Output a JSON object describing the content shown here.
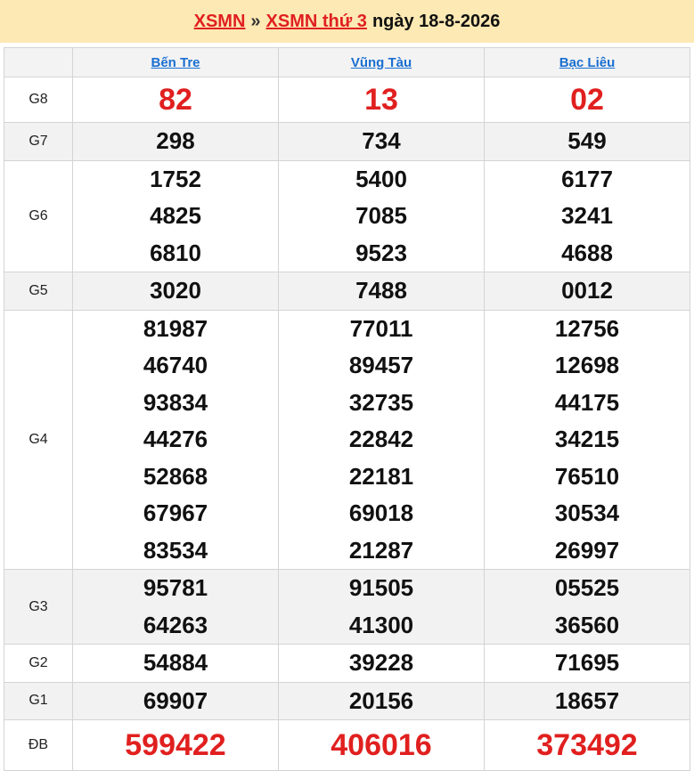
{
  "header": {
    "link1": "XSMN",
    "separator": "»",
    "link2": "XSMN thứ 3",
    "date_text": "ngày 18-8-2026"
  },
  "provinces": [
    "Bến Tre",
    "Vũng Tàu",
    "Bạc Liêu"
  ],
  "prizes": [
    {
      "label": "G8",
      "style": "g8",
      "shade": false,
      "values": [
        [
          "82"
        ],
        [
          "13"
        ],
        [
          "02"
        ]
      ]
    },
    {
      "label": "G7",
      "style": "",
      "shade": true,
      "values": [
        [
          "298"
        ],
        [
          "734"
        ],
        [
          "549"
        ]
      ]
    },
    {
      "label": "G6",
      "style": "",
      "shade": false,
      "values": [
        [
          "1752",
          "4825",
          "6810"
        ],
        [
          "5400",
          "7085",
          "9523"
        ],
        [
          "6177",
          "3241",
          "4688"
        ]
      ]
    },
    {
      "label": "G5",
      "style": "",
      "shade": true,
      "values": [
        [
          "3020"
        ],
        [
          "7488"
        ],
        [
          "0012"
        ]
      ]
    },
    {
      "label": "G4",
      "style": "",
      "shade": false,
      "values": [
        [
          "81987",
          "46740",
          "93834",
          "44276",
          "52868",
          "67967",
          "83534"
        ],
        [
          "77011",
          "89457",
          "32735",
          "22842",
          "22181",
          "69018",
          "21287"
        ],
        [
          "12756",
          "12698",
          "44175",
          "34215",
          "76510",
          "30534",
          "26997"
        ]
      ]
    },
    {
      "label": "G3",
      "style": "",
      "shade": true,
      "values": [
        [
          "95781",
          "64263"
        ],
        [
          "91505",
          "41300"
        ],
        [
          "05525",
          "36560"
        ]
      ]
    },
    {
      "label": "G2",
      "style": "",
      "shade": false,
      "values": [
        [
          "54884"
        ],
        [
          "39228"
        ],
        [
          "71695"
        ]
      ]
    },
    {
      "label": "G1",
      "style": "",
      "shade": true,
      "values": [
        [
          "69907"
        ],
        [
          "20156"
        ],
        [
          "18657"
        ]
      ]
    },
    {
      "label": "ĐB",
      "style": "db",
      "shade": false,
      "values": [
        [
          "599422"
        ],
        [
          "406016"
        ],
        [
          "373492"
        ]
      ]
    }
  ],
  "colors": {
    "header_bg": "#fde9b3",
    "link_red": "#e02020",
    "province_link": "#1a6fd1",
    "highlight_red": "#e0201f",
    "row_shade": "#f2f2f2"
  }
}
